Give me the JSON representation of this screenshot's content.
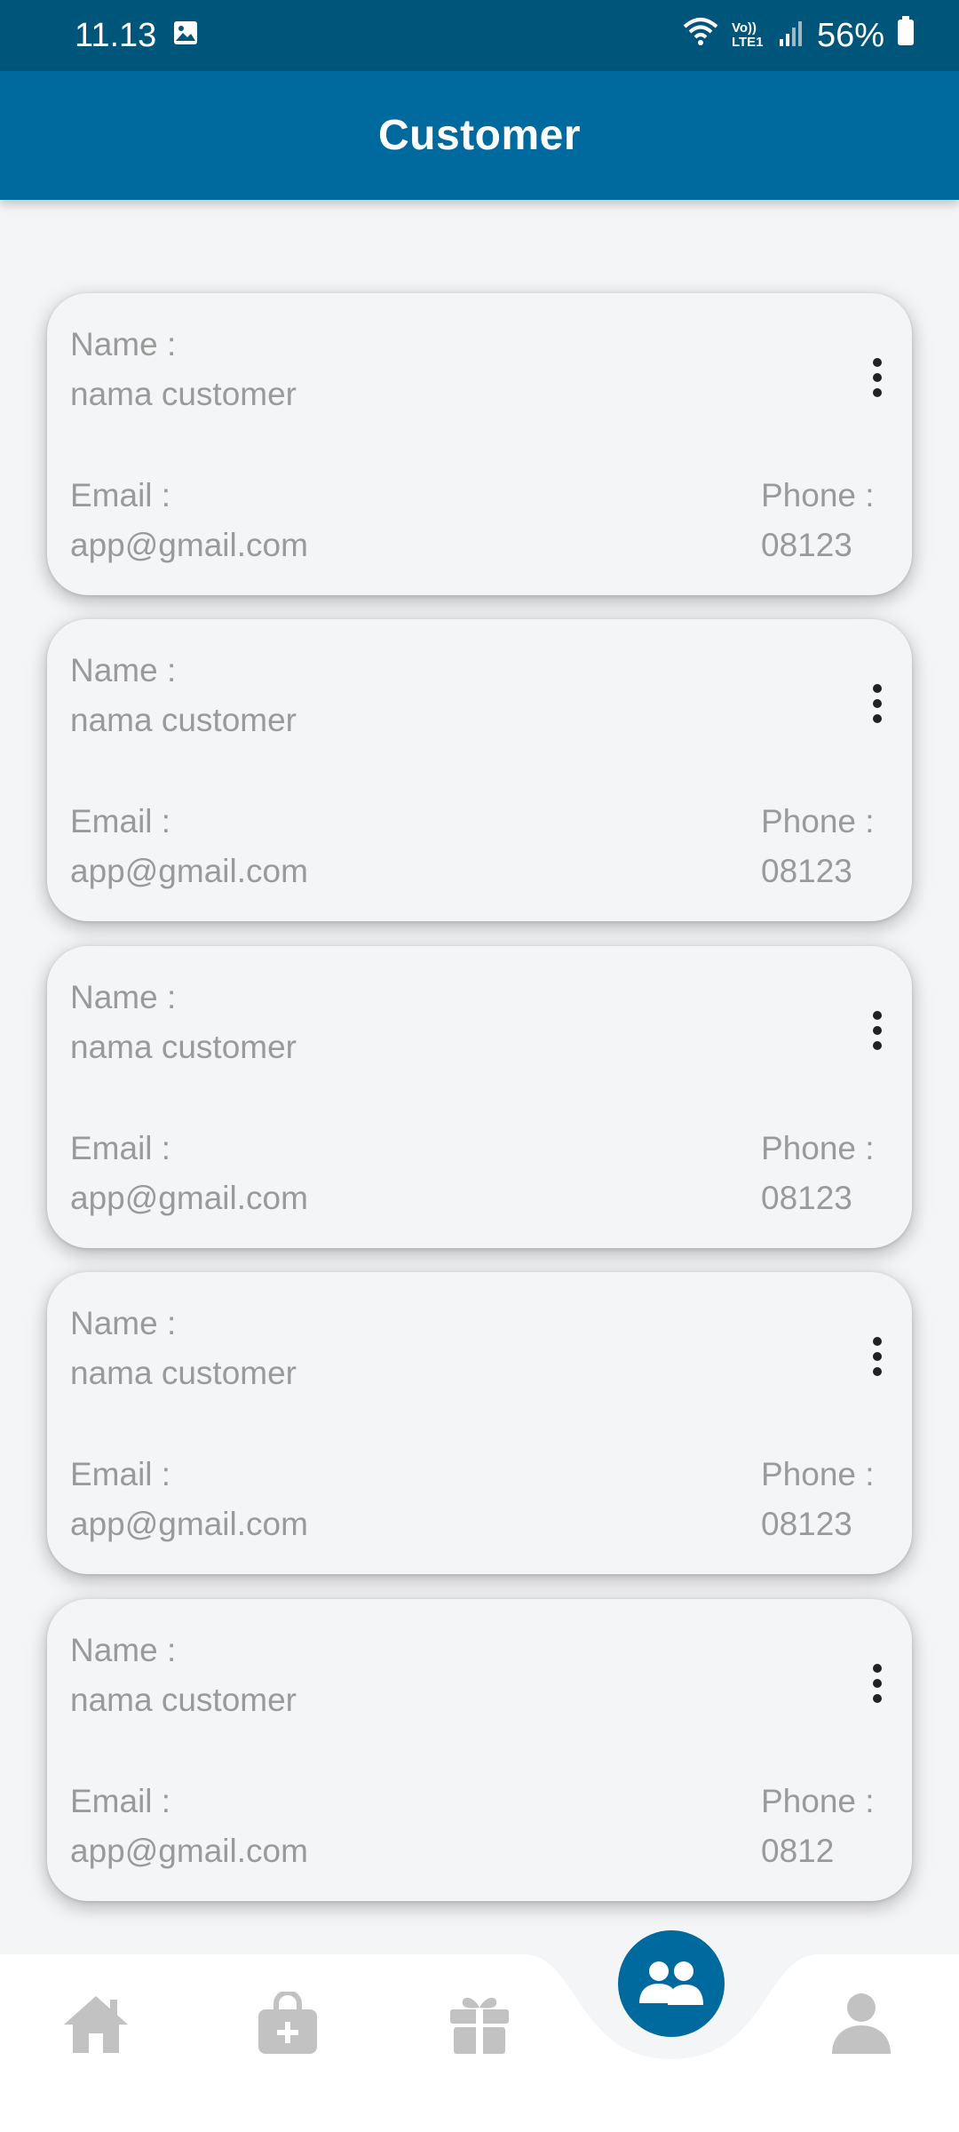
{
  "status_bar": {
    "time": "11.13",
    "battery": "56%",
    "network": "Vo)) LTE1"
  },
  "app_bar": {
    "title": "Customer"
  },
  "colors": {
    "primary": "#006a9f",
    "status_bar": "#00557a",
    "text_muted": "#9a9a9a",
    "background": "#f4f5f7"
  },
  "customers": [
    {
      "name_label": "Name :",
      "name": "nama customer",
      "email_label": "Email :",
      "email": "app@gmail.com",
      "phone_label": "Phone :",
      "phone": "08123"
    },
    {
      "name_label": "Name :",
      "name": "nama customer",
      "email_label": "Email :",
      "email": "app@gmail.com",
      "phone_label": "Phone :",
      "phone": "08123"
    },
    {
      "name_label": "Name :",
      "name": "nama customer",
      "email_label": "Email :",
      "email": "app@gmail.com",
      "phone_label": "Phone :",
      "phone": "08123"
    },
    {
      "name_label": "Name :",
      "name": "nama customer",
      "email_label": "Email :",
      "email": "app@gmail.com",
      "phone_label": "Phone :",
      "phone": "08123"
    },
    {
      "name_label": "Name :",
      "name": "nama customer",
      "email_label": "Email :",
      "email": "app@gmail.com",
      "phone_label": "Phone :",
      "phone": "0812"
    }
  ],
  "bottom_nav": {
    "items": [
      {
        "icon": "home-icon",
        "active": false
      },
      {
        "icon": "shopping-bag-plus-icon",
        "active": false
      },
      {
        "icon": "gift-icon",
        "active": false
      },
      {
        "icon": "users-icon",
        "active": true
      },
      {
        "icon": "user-icon",
        "active": false
      }
    ]
  }
}
